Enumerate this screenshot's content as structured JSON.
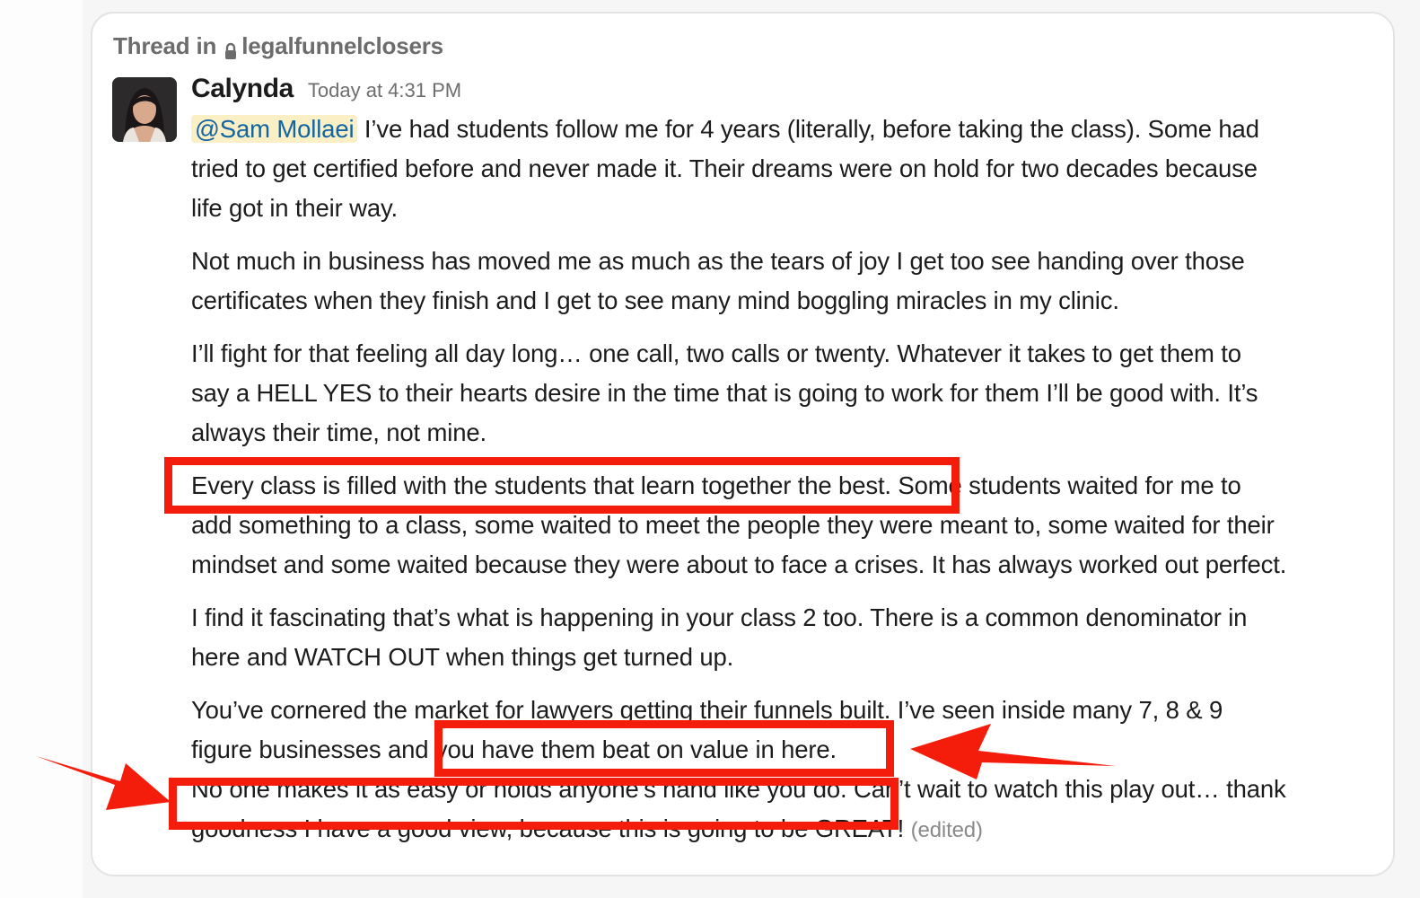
{
  "thread": {
    "prefix": "Thread in",
    "channel": "legalfunnelclosers",
    "channel_icon": "lock-icon"
  },
  "message": {
    "author": "Calynda",
    "timestamp": "Today at 4:31 PM",
    "avatar_icon": "user-avatar",
    "mention": "@Sam Mollaei",
    "lines": {
      "p1_l1": " I’ve had students follow me for 4 years (literally, before taking the class). Some had",
      "p1_l2": "tried to get certified before and never made it. Their dreams were on hold for two decades because",
      "p1_l3": "life got in their way.",
      "p2_l1": "Not much in business has moved me as much as the tears of joy I get too see handing over those",
      "p2_l2": "certificates when they finish and I get to see many mind boggling miracles in my clinic.",
      "p3_l1": "I’ll fight for that feeling all day long… one call, two calls or twenty. Whatever it takes to get them to",
      "p3_l2": "say a HELL YES to their hearts desire in the time that is going to work for them I’ll be good with. It’s",
      "p3_l3": "always their time, not mine.",
      "p4_l1": "Every class is filled with the students that learn together the best. Some students waited for me to",
      "p4_l2": "add something to a class, some waited to meet the people they were meant to, some waited for their",
      "p4_l3": "mindset and some waited because they were about to face a crises. It has always worked out perfect.",
      "p5_l1": "I find it fascinating that’s what is happening in your class 2 too. There is a common denominator in",
      "p5_l2": "here and WATCH OUT when things get turned up.",
      "p6_l1": "You’ve cornered the market for lawyers getting their funnels built. I’ve seen inside many 7, 8 & 9",
      "p6_l2": "figure businesses and you have them beat on value in here.",
      "p6_l3": "No one makes it as easy or holds anyone’s hand like you do. Can’t wait to watch this play out… thank",
      "p6_l4": "goodness I have a good view, because this is going to be GREAT!"
    },
    "edited_label": "(edited)"
  },
  "annotations": {
    "color": "#f41c0a"
  },
  "colors": {
    "mention_bg": "#fbefc5",
    "mention_text": "#1264a3",
    "text": "#1d1c1d",
    "muted": "#6e6e6e"
  }
}
